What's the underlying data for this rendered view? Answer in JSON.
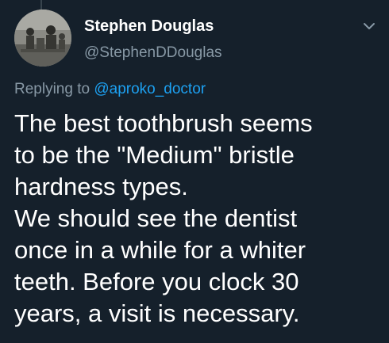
{
  "tweet": {
    "author": {
      "display_name": "Stephen Douglas",
      "handle": "@StephenDDouglas",
      "avatar_icon": "profile-photo"
    },
    "menu_icon": "chevron-down-icon",
    "reply": {
      "prefix": "Replying to",
      "mention": "@aproko_doctor"
    },
    "text_lines": [
      "The best toothbrush seems",
      "to be the \"Medium\" bristle",
      "hardness types.",
      "We should see the dentist",
      "once in a while for a whiter",
      "teeth. Before you clock 30",
      "years, a visit is necessary."
    ]
  },
  "colors": {
    "background": "#15202b",
    "primary_text": "#ffffff",
    "secondary_text": "#8899a6",
    "link": "#1da1f2"
  }
}
